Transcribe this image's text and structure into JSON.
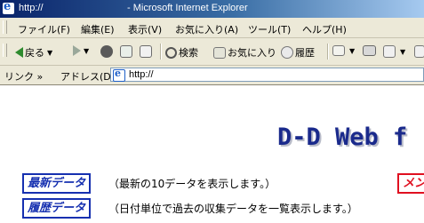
{
  "window": {
    "title_url": "http://",
    "title_app": "- Microsoft Internet Explorer"
  },
  "menu": {
    "items": [
      "ファイル(F)",
      "編集(E)",
      "表示(V)",
      "お気に入り(A)",
      "ツール(T)",
      "ヘルプ(H)"
    ]
  },
  "toolbar": {
    "back_label": "戻る",
    "search_label": "検索",
    "favorites_label": "お気に入り",
    "history_label": "履歴"
  },
  "addressbar": {
    "links_label": "リンク »",
    "address_label": "アドレス(D)",
    "url": "http://"
  },
  "page": {
    "title": "D-D Web  f",
    "latest_button": "最新データ",
    "latest_desc": "（最新の10データを表示します。）",
    "history_button": "履歴データ",
    "history_desc": "（日付単位で過去の収集データを一覧表示します。）",
    "mail_button": "メン"
  },
  "colors": {
    "title_text": "#1a2a8c",
    "nav_border": "#1630b0",
    "mail_accent": "#e01020"
  },
  "icons": [
    "ie-logo-icon",
    "back-arrow-icon",
    "forward-arrow-icon",
    "stop-icon",
    "refresh-icon",
    "home-icon",
    "search-icon",
    "favorites-icon",
    "history-icon",
    "mail-icon",
    "print-icon",
    "edit-icon"
  ]
}
